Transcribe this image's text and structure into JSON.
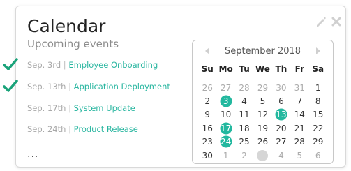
{
  "widget": {
    "title": "Calendar",
    "subtitle": "Upcoming events",
    "icons": [
      "pencil-icon",
      "close-icon"
    ]
  },
  "events": [
    {
      "date": "Sep. 3rd",
      "separator": "|",
      "name": "Employee Onboarding",
      "checked": true
    },
    {
      "date": "Sep. 13th",
      "separator": "|",
      "name": "Application Deployment",
      "checked": true
    },
    {
      "date": "Sep. 17th",
      "separator": "|",
      "name": "System Update",
      "checked": false
    },
    {
      "date": "Sep. 24th",
      "separator": "|",
      "name": "Product Release",
      "checked": false
    }
  ],
  "more_label": "...",
  "calendar": {
    "month_label": "September 2018",
    "weekdays": [
      "Su",
      "Mo",
      "Tu",
      "We",
      "Th",
      "Fr",
      "Sa"
    ],
    "weeks": [
      [
        {
          "d": "26",
          "other": true
        },
        {
          "d": "27",
          "other": true
        },
        {
          "d": "28",
          "other": true
        },
        {
          "d": "29",
          "other": true
        },
        {
          "d": "30",
          "other": true
        },
        {
          "d": "31",
          "other": true
        },
        {
          "d": "1"
        }
      ],
      [
        {
          "d": "2"
        },
        {
          "d": "3",
          "marked": true
        },
        {
          "d": "4"
        },
        {
          "d": "5"
        },
        {
          "d": "6"
        },
        {
          "d": "7"
        },
        {
          "d": "8"
        }
      ],
      [
        {
          "d": "9"
        },
        {
          "d": "10"
        },
        {
          "d": "11"
        },
        {
          "d": "12"
        },
        {
          "d": "13",
          "marked": true
        },
        {
          "d": "14"
        },
        {
          "d": "15"
        }
      ],
      [
        {
          "d": "16"
        },
        {
          "d": "17",
          "marked": true
        },
        {
          "d": "18"
        },
        {
          "d": "19"
        },
        {
          "d": "20"
        },
        {
          "d": "21"
        },
        {
          "d": "22"
        }
      ],
      [
        {
          "d": "23"
        },
        {
          "d": "24",
          "marked": true
        },
        {
          "d": "25"
        },
        {
          "d": "26"
        },
        {
          "d": "27"
        },
        {
          "d": "28"
        },
        {
          "d": "29"
        }
      ],
      [
        {
          "d": "30"
        },
        {
          "d": "1",
          "other": true
        },
        {
          "d": "2",
          "other": true
        },
        {
          "d": "",
          "other": true,
          "blank": true
        },
        {
          "d": "4",
          "other": true
        },
        {
          "d": "5",
          "other": true
        },
        {
          "d": "6",
          "other": true
        }
      ]
    ]
  },
  "colors": {
    "accent": "#23b89f",
    "event_link": "#29b6a0",
    "checkmark": "#1aa37a"
  }
}
